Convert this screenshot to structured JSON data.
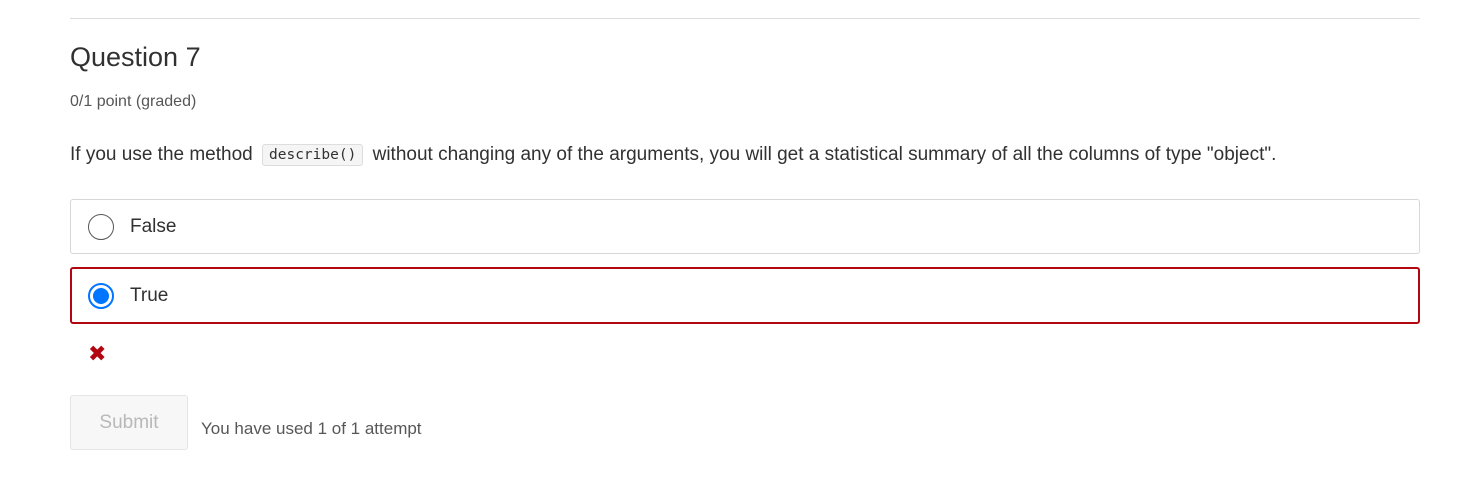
{
  "question": {
    "title": "Question 7",
    "score": "0/1 point (graded)",
    "prompt_before": "If you use the method",
    "prompt_code": "describe()",
    "prompt_after": "without changing any of the arguments, you will get a statistical summary of all the columns of type \"object\".",
    "options": [
      {
        "label": "False",
        "selected": false
      },
      {
        "label": "True",
        "selected": true
      }
    ],
    "result_icon": "incorrect-x-icon",
    "result_color": "#b20610"
  },
  "actions": {
    "submit_label": "Submit",
    "attempts_text": "You have used 1 of 1 attempt"
  },
  "colors": {
    "selected_radio": "#0075ff",
    "incorrect_border": "#b20610"
  }
}
